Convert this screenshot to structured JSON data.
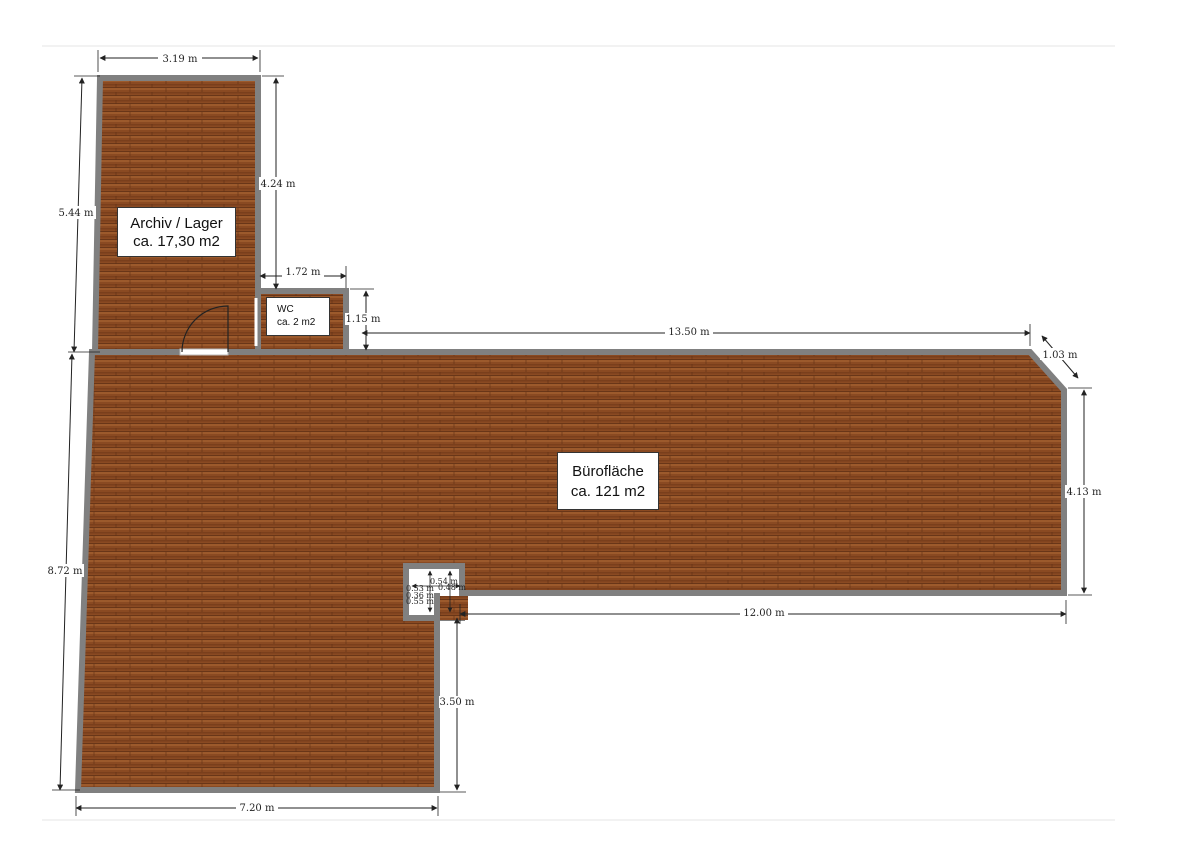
{
  "rooms": {
    "archiv": {
      "name": "Archiv / Lager",
      "area": "ca. 17,30 m2"
    },
    "wc": {
      "name": "WC",
      "area": "ca. 2 m2"
    },
    "buero": {
      "name": "Bürofläche",
      "area": "ca. 121 m2"
    }
  },
  "dimensions": {
    "archiv_width": "3.19 m",
    "archiv_height_left": "5.44 m",
    "archiv_height_right": "4.24 m",
    "wc_width": "1.72 m",
    "wc_height": "1.15 m",
    "top_length": "13.50 m",
    "corner_chamfer": "1.03 m",
    "right_height": "4.13 m",
    "left_height": "8.72 m",
    "lower_step": "12.00 m",
    "lower_right_height": "3.50 m",
    "bottom_width": "7.20 m",
    "niche_a": "0.54 m",
    "niche_b": "0.53 m",
    "niche_c": "0.48 m",
    "niche_d": "0.36 m",
    "niche_e": "0.55 m"
  },
  "colors": {
    "floor": "#8a4a22",
    "wall": "#808080"
  }
}
